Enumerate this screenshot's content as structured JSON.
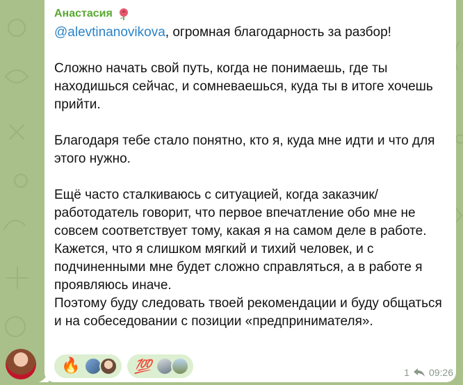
{
  "message": {
    "sender": "Анастасия",
    "sender_emoji_icon": "rose-icon",
    "mention": "@alevtinanovikova",
    "first_line_rest": ", огромная благодарность за разбор!",
    "paragraphs": [
      "Сложно начать свой путь, когда не понимаешь, где ты находишься сейчас, и сомневаешься, куда ты в итоге хочешь прийти.",
      "Благодаря тебе стало понятно, кто я, куда мне идти и что для этого нужно.",
      "Ещё часто сталкиваюсь с ситуацией, когда заказчик/работодатель говорит, что первое впечатление обо мне не совсем соответствует тому, какая я на самом деле в работе.\nКажется, что я слишком мягкий и тихий человек, и с подчиненными мне будет сложно справляться, а в работе я проявляюсь иначе.\nПоэтому буду следовать твоей рекомендации и буду общаться и на собеседовании с позиции «предпринимателя»."
    ],
    "reply_count": "1",
    "time": "09:26"
  },
  "reactions": [
    {
      "emoji": "🔥",
      "name": "fire"
    },
    {
      "emoji": "💯",
      "name": "hundred"
    }
  ],
  "colors": {
    "sender": "#5aa833",
    "mention": "#2a83c8",
    "reaction_bg": "#dcefd0"
  }
}
